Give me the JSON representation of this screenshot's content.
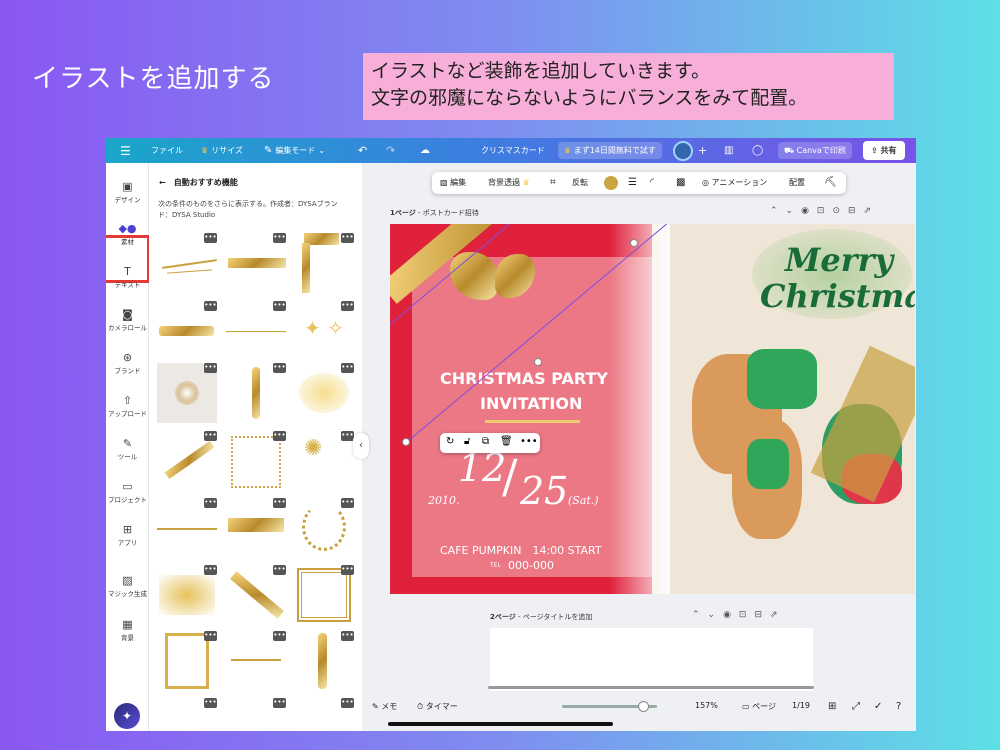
{
  "slide": {
    "title": "イラストを追加する",
    "note_line1": "イラストなど装飾を追加していきます。",
    "note_line2": "文字の邪魔にならないようにバランスをみて配置。"
  },
  "topbar": {
    "menu_icon": "hamburger-icon",
    "file": "ファイル",
    "resize": "リサイズ",
    "edit_mode": "編集モード",
    "doc_title": "クリスマスカード",
    "trial": "まず14日間無料で試す",
    "print": "Canvaで印刷",
    "share": "共有",
    "colors": {
      "start": "#1aa6c9",
      "end": "#7a52e8",
      "crown": "#f5c542"
    }
  },
  "rail": {
    "items": [
      {
        "label": "デザイン",
        "icon": "layout-icon"
      },
      {
        "label": "素材",
        "icon": "elements-icon"
      },
      {
        "label": "テキスト",
        "icon": "text-icon"
      },
      {
        "label": "カメラロール",
        "icon": "camera-icon"
      },
      {
        "label": "ブランド",
        "icon": "brand-icon"
      },
      {
        "label": "アップロード",
        "icon": "upload-icon"
      },
      {
        "label": "ツール",
        "icon": "draw-icon"
      },
      {
        "label": "プロジェクト",
        "icon": "folder-icon"
      },
      {
        "label": "アプリ",
        "icon": "apps-icon"
      },
      {
        "label": "マジック生成",
        "icon": "magic-icon"
      },
      {
        "label": "背景",
        "icon": "background-icon"
      }
    ],
    "active_index": 1
  },
  "panel": {
    "heading": "自動おすすめ機能",
    "description": "次の条件のものをさらに表示する。作成者：DYSAブランド：DYSA Studio",
    "more_label": "•••"
  },
  "context_toolbar": {
    "edit": "編集",
    "bg_remove": "背景透過",
    "flip": "反転",
    "animate": "アニメーション",
    "arrange": "配置",
    "swatch_color": "#c9a640"
  },
  "page1": {
    "label_bold": "1ページ",
    "label_rest": " - ポストカード招待"
  },
  "card": {
    "line1": "CHRISTMAS  PARTY",
    "line2": "INVITATION",
    "date_month": "12",
    "date_slash": "/",
    "date_day": "25",
    "year": "2010.",
    "weekday": "(Sat.)",
    "venue": "CAFE PUMPKIN　14:00 START",
    "tel_prefix": "TEL",
    "tel": "000-000",
    "merry": "Merry",
    "christmas": "Christmas",
    "colors": {
      "red": "#e0213b",
      "green": "#1a6b3a",
      "gold": "#c9a040"
    }
  },
  "page2": {
    "label_bold": "2ページ",
    "label_rest": " - ページタイトルを追加"
  },
  "bottombar": {
    "notes": "メモ",
    "timer": "タイマー",
    "zoom": "157%",
    "zoom_fraction": 0.85,
    "pages": "ページ",
    "page_count": "1/19"
  }
}
